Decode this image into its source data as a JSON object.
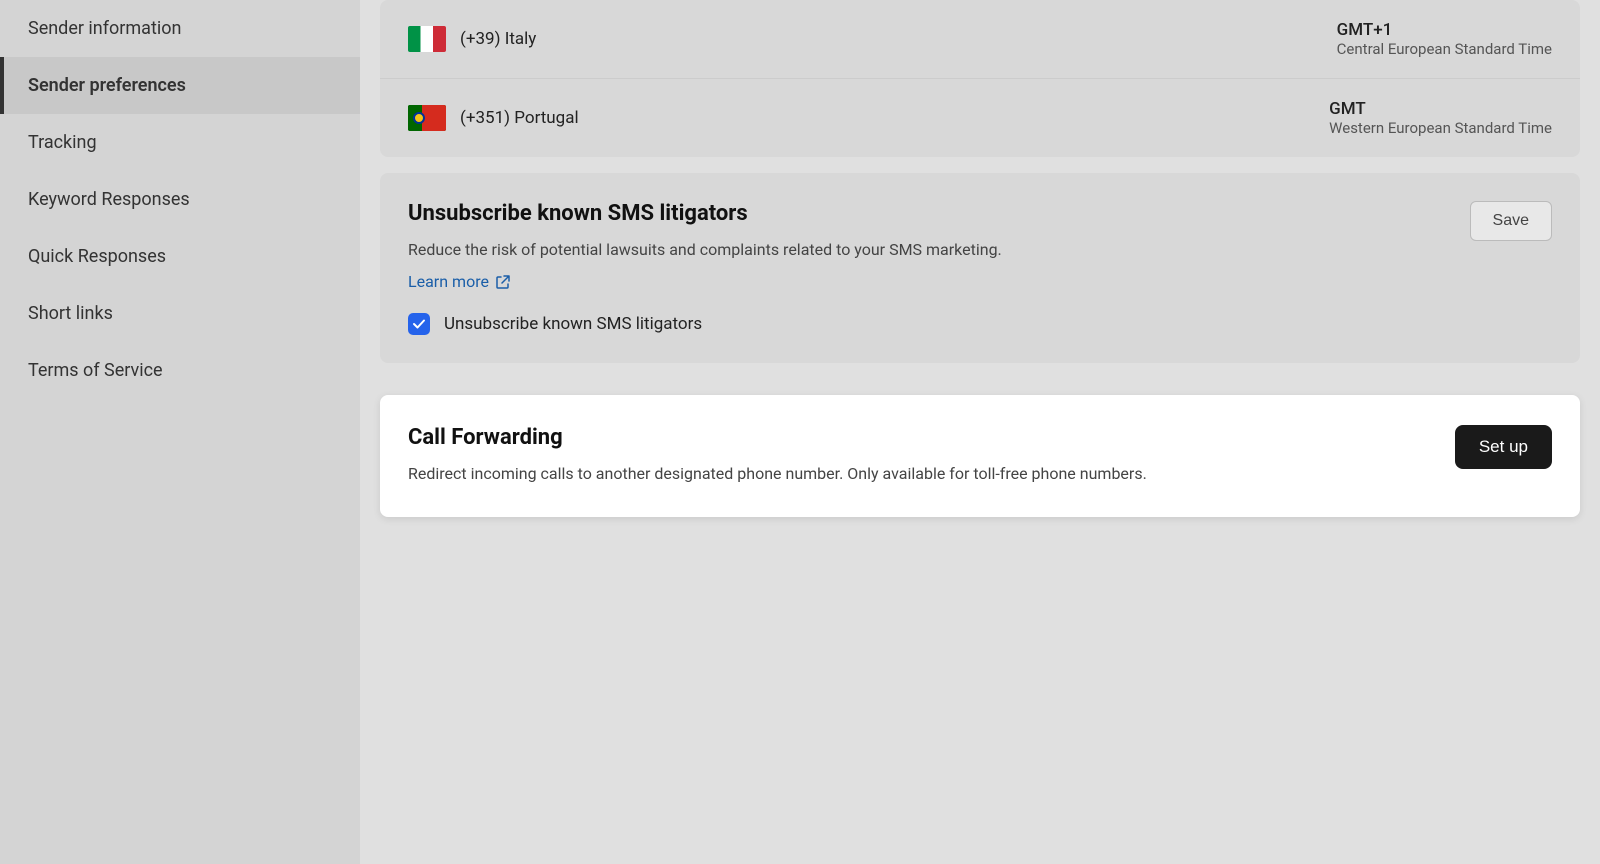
{
  "sidebar": {
    "items": [
      {
        "id": "sender-information",
        "label": "Sender information",
        "active": false
      },
      {
        "id": "sender-preferences",
        "label": "Sender preferences",
        "active": true
      },
      {
        "id": "tracking",
        "label": "Tracking",
        "active": false
      },
      {
        "id": "keyword-responses",
        "label": "Keyword Responses",
        "active": false
      },
      {
        "id": "quick-responses",
        "label": "Quick Responses",
        "active": false
      },
      {
        "id": "short-links",
        "label": "Short links",
        "active": false
      },
      {
        "id": "terms-of-service",
        "label": "Terms of Service",
        "active": false
      }
    ]
  },
  "main": {
    "timezones": [
      {
        "country": "(+39) Italy",
        "flag": "italy",
        "gmt": "GMT+1",
        "tz_label": "Central European Standard Time"
      },
      {
        "country": "(+351) Portugal",
        "flag": "portugal",
        "gmt": "GMT",
        "tz_label": "Western European Standard Time"
      }
    ],
    "unsubscribe_section": {
      "title": "Unsubscribe known SMS litigators",
      "description": "Reduce the risk of potential lawsuits and complaints related to your SMS marketing.",
      "learn_more_label": "Learn more",
      "checkbox_label": "Unsubscribe known SMS litigators",
      "save_button": "Save"
    },
    "call_forwarding": {
      "title": "Call Forwarding",
      "description": "Redirect incoming calls to another designated phone number. Only available for toll-free phone numbers.",
      "setup_button": "Set up"
    }
  },
  "colors": {
    "checkbox_checked": "#2563eb",
    "link_color": "#1a5ea8",
    "setup_btn_bg": "#1a1a1a"
  }
}
